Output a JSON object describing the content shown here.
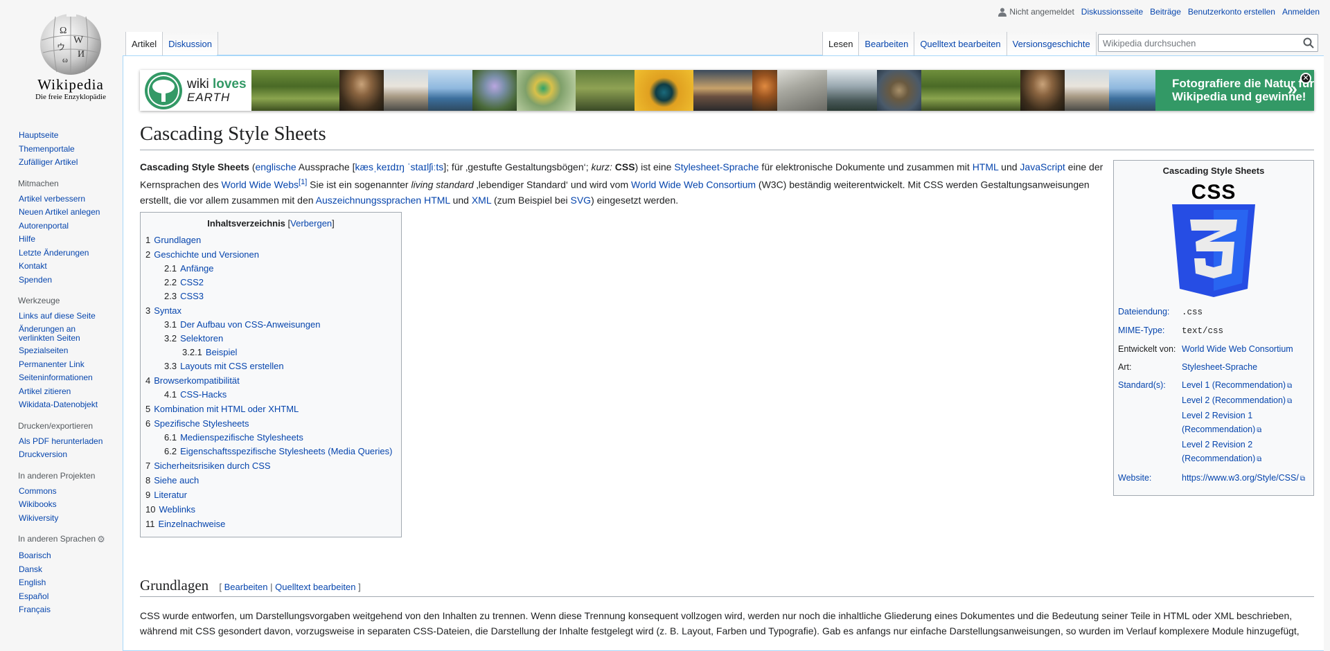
{
  "logo": {
    "wordmark": "Wikipedia",
    "tagline": "Die freie Enzyklopädie"
  },
  "sidebar": {
    "nav": [
      "Hauptseite",
      "Themenportale",
      "Zufälliger Artikel"
    ],
    "mitmachen": {
      "heading": "Mitmachen",
      "items": [
        "Artikel verbessern",
        "Neuen Artikel anlegen",
        "Autorenportal",
        "Hilfe",
        "Letzte Änderungen",
        "Kontakt",
        "Spenden"
      ]
    },
    "werkzeuge": {
      "heading": "Werkzeuge",
      "items": [
        "Links auf diese Seite",
        "Änderungen an verlinkten Seiten",
        "Spezialseiten",
        "Permanenter Link",
        "Seiteninformationen",
        "Artikel zitieren",
        "Wikidata-Datenobjekt"
      ]
    },
    "drucken": {
      "heading": "Drucken/exportieren",
      "items": [
        "Als PDF herunterladen",
        "Druckversion"
      ]
    },
    "projekte": {
      "heading": "In anderen Projekten",
      "items": [
        "Commons",
        "Wikibooks",
        "Wikiversity"
      ]
    },
    "sprachen": {
      "heading": "In anderen Sprachen",
      "items": [
        "Boarisch",
        "Dansk",
        "English",
        "Español",
        "Français"
      ]
    }
  },
  "personal": {
    "status": "Nicht angemeldet",
    "links": [
      "Diskussionsseite",
      "Beiträge",
      "Benutzerkonto erstellen",
      "Anmelden"
    ]
  },
  "tabs": {
    "left": [
      "Artikel",
      "Diskussion"
    ],
    "right": [
      "Lesen",
      "Bearbeiten",
      "Quelltext bearbeiten",
      "Versionsgeschichte"
    ]
  },
  "search": {
    "placeholder": "Wikipedia durchsuchen"
  },
  "banner": {
    "logo_line1_a": "wiki ",
    "logo_line1_b": "loves",
    "logo_line2": "EARTH",
    "cta_line1": "Fotografiere die Natur für",
    "cta_line2": "Wikipedia und gewinne!",
    "cta_arrow": "»",
    "close": "✕",
    "colors": {
      "green": "#339966"
    }
  },
  "article": {
    "title": "Cascading Style Sheets",
    "lead": {
      "t1": "Cascading Style Sheets",
      "t2": " (",
      "l1": "englische",
      "t3": " Aussprache [",
      "l2": "kæsˌkeɪdɪŋ ˈstaɪlʃiːts",
      "t4": "]; für ‚gestufte Gestaltungsbögen‘; ",
      "t5": "kurz:",
      "t6": " ",
      "t7": "CSS",
      "t8": ") ist eine ",
      "l3": "Stylesheet-Sprache",
      "t9": " für elektronische Dokumente und zusammen mit ",
      "l4": "HTML",
      "t10": " und ",
      "l5": "JavaScript",
      "t11": " eine der Kernsprachen des ",
      "l6": "World Wide Webs",
      "ref1": "[1]",
      "t12": " Sie ist ein sogenannter ",
      "t13": "living standard",
      "t14": " ‚lebendiger Standard‘ und wird vom ",
      "l7": "World Wide Web Consortium",
      "t15": " (W3C) beständig weiterentwickelt. Mit CSS werden Gestaltungsanweisungen erstellt, die vor allem zusammen mit den ",
      "l8": "Auszeichnungssprachen HTML",
      "t16": " und ",
      "l9": "XML",
      "t17": " (zum Beispiel bei ",
      "l10": "SVG",
      "t18": ") eingesetzt werden."
    }
  },
  "infobox": {
    "title": "Cascading Style Sheets",
    "logo_text": "CSS",
    "rows": [
      {
        "key": "Dateiendung:",
        "val": ".css"
      },
      {
        "key": "MIME-Type:",
        "val": "text/css"
      },
      {
        "key": "Entwickelt von:",
        "val": "World Wide Web Consortium"
      },
      {
        "key": "Art:",
        "val": "Stylesheet-Sprache"
      },
      {
        "key": "Standard(s):",
        "vals": [
          "Level 1 (Recommendation)",
          "Level 2 (Recommendation)",
          "Level 2 Revision 1 (Recommendation)",
          "Level 2 Revision 2 (Recommendation)"
        ]
      },
      {
        "key": "Website:",
        "val": "https://www.w3.org/Style/CSS/"
      }
    ]
  },
  "toc": {
    "title": "Inhaltsverzeichnis",
    "toggle": "Verbergen",
    "items": [
      {
        "num": "1",
        "label": "Grundlagen",
        "level": 1
      },
      {
        "num": "2",
        "label": "Geschichte und Versionen",
        "level": 1
      },
      {
        "num": "2.1",
        "label": "Anfänge",
        "level": 2
      },
      {
        "num": "2.2",
        "label": "CSS2",
        "level": 2
      },
      {
        "num": "2.3",
        "label": "CSS3",
        "level": 2
      },
      {
        "num": "3",
        "label": "Syntax",
        "level": 1
      },
      {
        "num": "3.1",
        "label": "Der Aufbau von CSS-Anweisungen",
        "level": 2
      },
      {
        "num": "3.2",
        "label": "Selektoren",
        "level": 2
      },
      {
        "num": "3.2.1",
        "label": "Beispiel",
        "level": 3
      },
      {
        "num": "3.3",
        "label": "Layouts mit CSS erstellen",
        "level": 2
      },
      {
        "num": "4",
        "label": "Browserkompatibilität",
        "level": 1
      },
      {
        "num": "4.1",
        "label": "CSS-Hacks",
        "level": 2
      },
      {
        "num": "5",
        "label": "Kombination mit HTML oder XHTML",
        "level": 1
      },
      {
        "num": "6",
        "label": "Spezifische Stylesheets",
        "level": 1
      },
      {
        "num": "6.1",
        "label": "Medienspezifische Stylesheets",
        "level": 2
      },
      {
        "num": "6.2",
        "label": "Eigenschaftsspezifische Stylesheets (Media Queries)",
        "level": 2
      },
      {
        "num": "7",
        "label": "Sicherheitsrisiken durch CSS",
        "level": 1
      },
      {
        "num": "8",
        "label": "Siehe auch",
        "level": 1
      },
      {
        "num": "9",
        "label": "Literatur",
        "level": 1
      },
      {
        "num": "10",
        "label": "Weblinks",
        "level": 1
      },
      {
        "num": "11",
        "label": "Einzelnachweise",
        "level": 1
      }
    ]
  },
  "section": {
    "heading": "Grundlagen",
    "edit_open": "[ ",
    "edit1": "Bearbeiten",
    "edit_sep": " | ",
    "edit2": "Quelltext bearbeiten",
    "edit_close": " ]",
    "para": "CSS wurde entworfen, um Darstellungsvorgaben weitgehend von den Inhalten zu trennen. Wenn diese Trennung konsequent vollzogen wird, werden nur noch die inhaltliche Gliederung eines Dokumentes und die Bedeutung seiner Teile in HTML oder XML beschrieben, während mit CSS gesondert davon, vorzugsweise in separaten CSS-Dateien, die Darstellung der Inhalte festgelegt wird (z. B. Layout, Farben und Typografie). Gab es anfangs nur einfache Darstellungsanweisungen, so wurden im Verlauf komplexere Module hinzugefügt,"
  },
  "colors": {
    "link": "#0645ad",
    "border": "#a2a9b1",
    "css3_blue": "#2965f1",
    "css3_dark": "#264de4"
  }
}
